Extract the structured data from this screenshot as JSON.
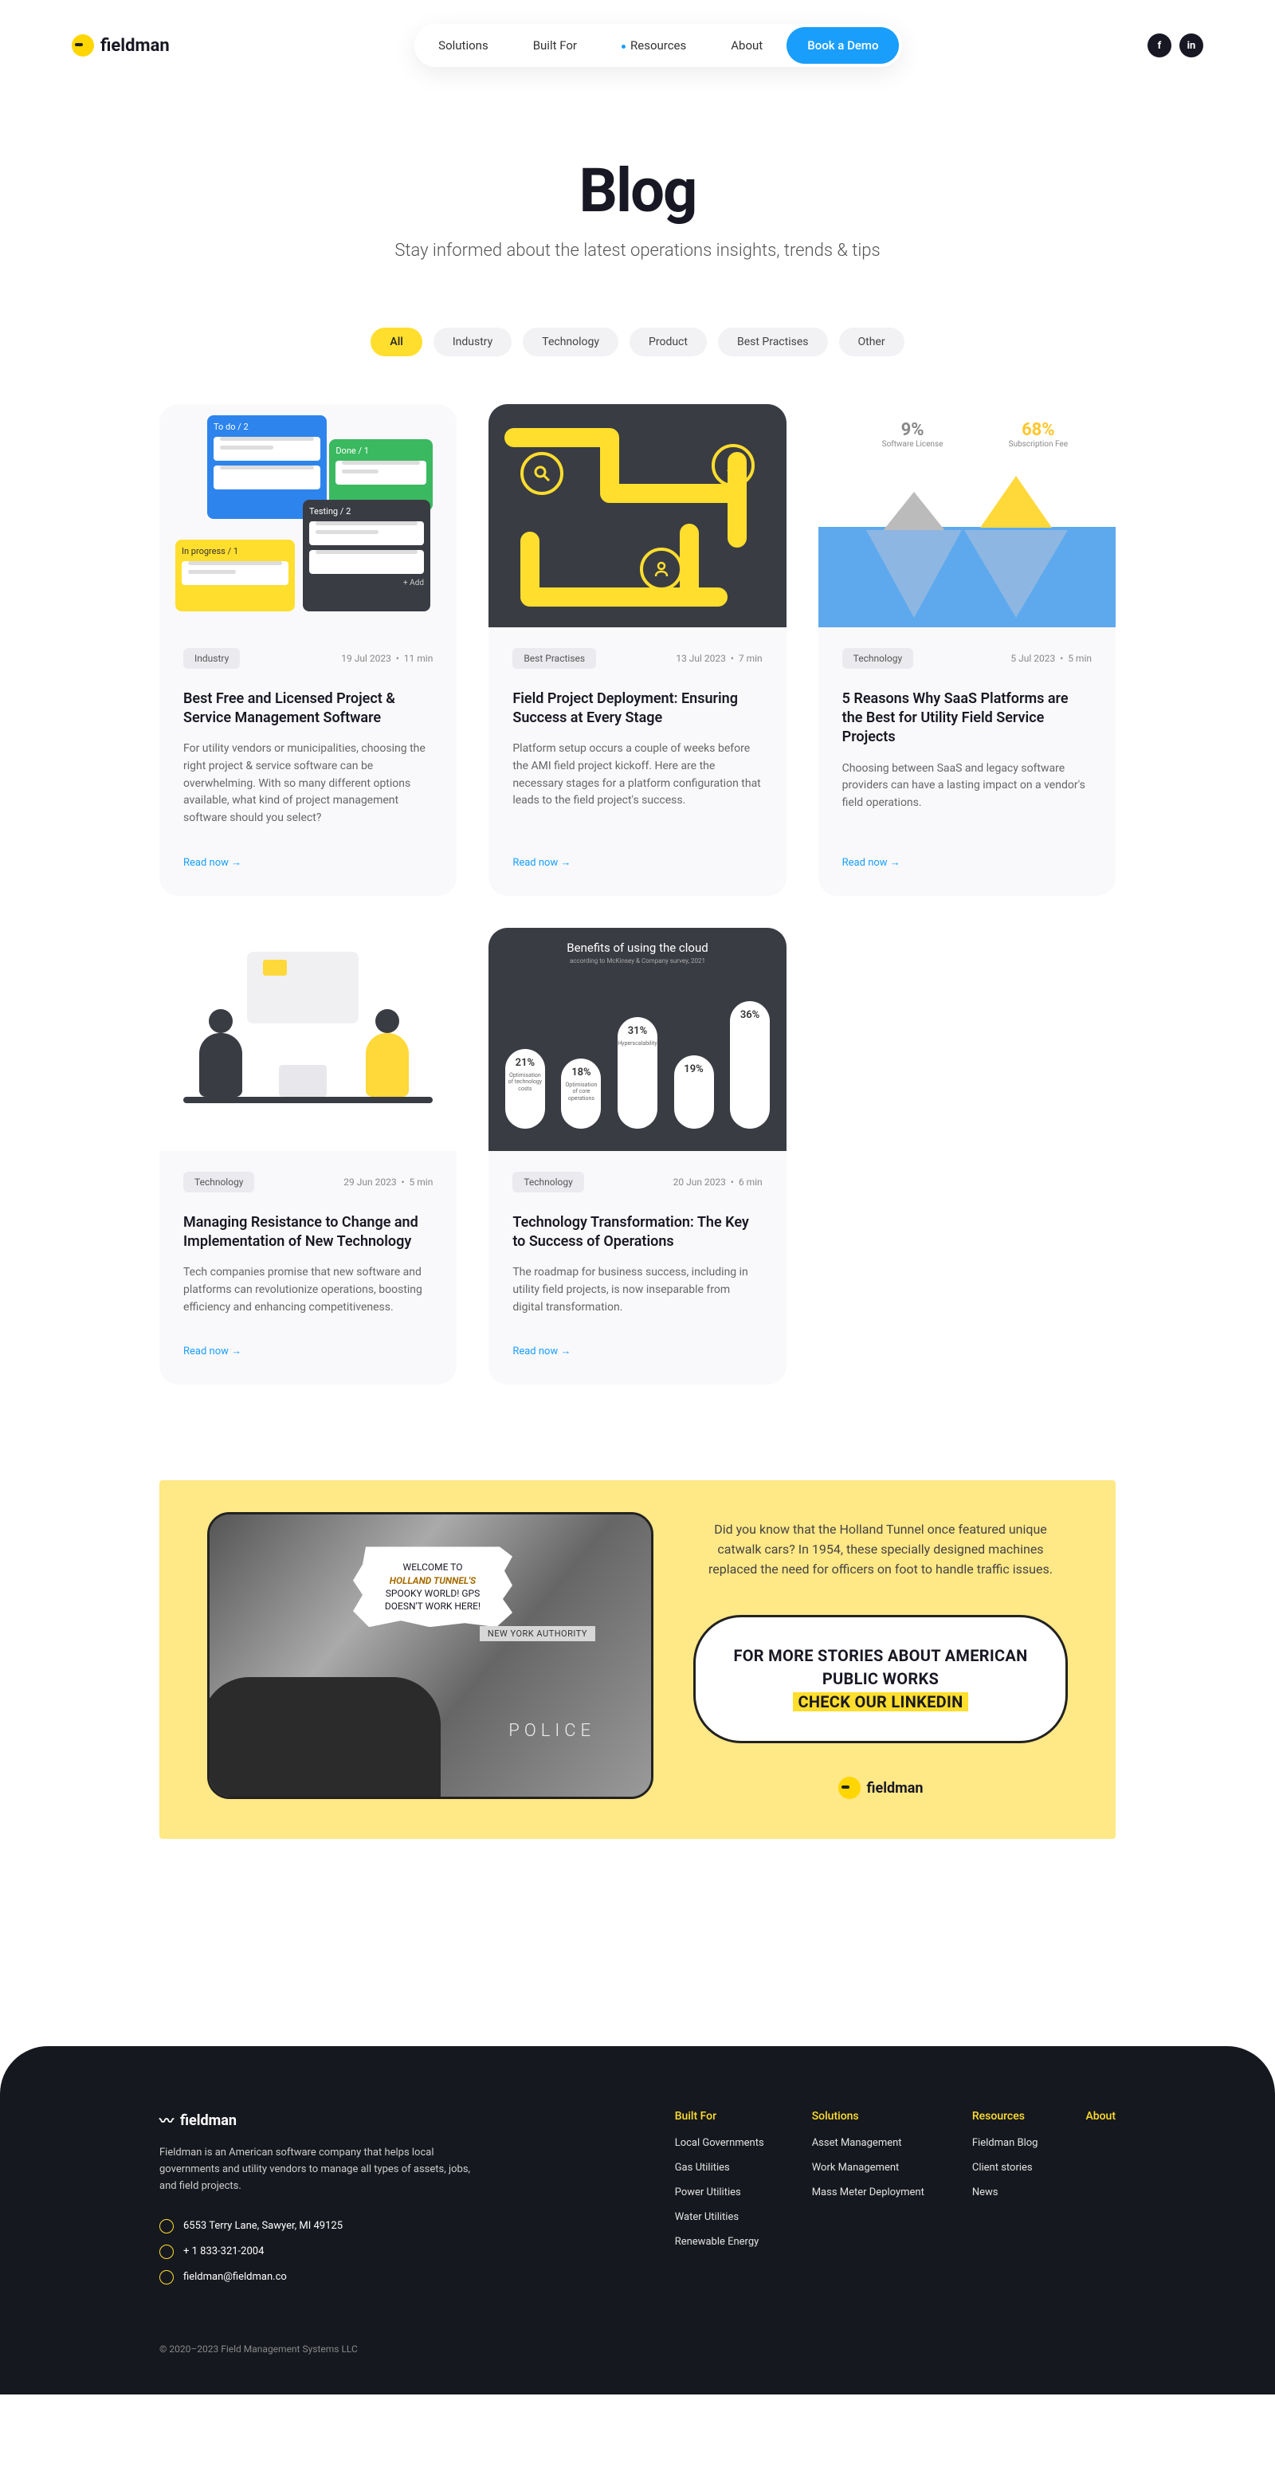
{
  "brand": "fieldman",
  "nav": {
    "items": [
      "Solutions",
      "Built For",
      "Resources",
      "About"
    ],
    "dotIndex": 2,
    "cta": "Book a Demo"
  },
  "hero": {
    "title": "Blog",
    "subtitle": "Stay informed about the latest operations insights, trends & tips"
  },
  "filters": [
    "All",
    "Industry",
    "Technology",
    "Product",
    "Best Practises",
    "Other"
  ],
  "activeFilter": 0,
  "posts": [
    {
      "tag": "Industry",
      "date": "19 Jul 2023",
      "read": "11 min",
      "title": "Best Free and Licensed Project & Service Management Software",
      "excerpt": "For utility vendors or municipalities, choosing the right project & service software can be overwhelming. With so many different options available, what kind of project management software should you select?",
      "thumb": "kanban",
      "kanban": {
        "todo": "To do / 2",
        "done": "Done / 1",
        "testing": "Testing / 2",
        "progress": "In progress / 1"
      }
    },
    {
      "tag": "Best Practises",
      "date": "13 Jul 2023",
      "read": "7 min",
      "title": "Field Project Deployment: Ensuring Success at Every Stage",
      "excerpt": "Platform setup occurs a couple of weeks before the AMI field project kickoff. Here are the necessary stages for a platform configuration that leads to the field project's success.",
      "thumb": "maze"
    },
    {
      "tag": "Technology",
      "date": "5 Jul 2023",
      "read": "5 min",
      "title": "5 Reasons Why SaaS Platforms are the Best for Utility Field Service Projects",
      "excerpt": "Choosing between SaaS and legacy software providers can have a lasting impact on a vendor's field operations.",
      "thumb": "iceberg",
      "iceberg": {
        "left": {
          "pct": "9%",
          "label": "Software License"
        },
        "right": {
          "pct": "68%",
          "label": "Subscription Fee"
        }
      }
    },
    {
      "tag": "Technology",
      "date": "29 Jun 2023",
      "read": "5 min",
      "title": "Managing Resistance to Change and Implementation of New Technology",
      "excerpt": "Tech companies promise that new software and platforms can revolutionize operations, boosting efficiency and enhancing competitiveness.",
      "thumb": "people"
    },
    {
      "tag": "Technology",
      "date": "20 Jun 2023",
      "read": "6 min",
      "title": "Technology Transformation: The Key to Success of Operations",
      "excerpt": "The roadmap for business success, including in utility field projects, is now inseparable from digital transformation.",
      "thumb": "bars",
      "bars": {
        "title": "Benefits of using the cloud",
        "subtitle": "according to McKinsey & Company survey, 2021",
        "cols": [
          {
            "pct": "21%",
            "label": "Optimisation of technology costs",
            "h": 100
          },
          {
            "pct": "18%",
            "label": "Optimisation of core operations",
            "h": 88
          },
          {
            "pct": "31%",
            "label": "Hyperscalability",
            "h": 140
          },
          {
            "pct": "19%",
            "label": "",
            "h": 92
          },
          {
            "pct": "36%",
            "label": "",
            "h": 160
          }
        ]
      }
    }
  ],
  "readNow": "Read now",
  "banner": {
    "text": "Did you know that the Holland Tunnel once featured unique catwalk cars? In 1954, these specially designed machines replaced the need for officers on foot to handle traffic issues.",
    "speech": {
      "line1": "WELCOME TO",
      "brand": "HOLLAND TUNNEL'S",
      "line2": "SPOOKY WORLD! GPS DOESN'T WORK HERE!"
    },
    "truck": "NEW YORK AUTHORITY",
    "police": "POLICE",
    "cta1": "FOR MORE STORIES ABOUT AMERICAN PUBLIC WORKS",
    "cta2": "CHECK OUR LINKEDIN"
  },
  "footer": {
    "about": "Fieldman is an American software company that helps local governments and utility vendors to manage all types of assets, jobs, and field projects.",
    "address": "6553 Terry Lane, Sawyer, MI 49125",
    "phone": "+ 1 833-321-2004",
    "email": "fieldman@fieldman.co",
    "cols": [
      {
        "title": "Built For",
        "links": [
          "Local Governments",
          "Gas Utilities",
          "Power Utilities",
          "Water Utilities",
          "Renewable Energy"
        ]
      },
      {
        "title": "Solutions",
        "links": [
          "Asset Management",
          "Work Management",
          "Mass Meter Deployment"
        ]
      },
      {
        "title": "Resources",
        "links": [
          "Fieldman Blog",
          "Client stories",
          "News"
        ]
      },
      {
        "title": "About",
        "links": []
      }
    ],
    "copyright": "© 2020–2023 Field Management Systems LLC"
  }
}
